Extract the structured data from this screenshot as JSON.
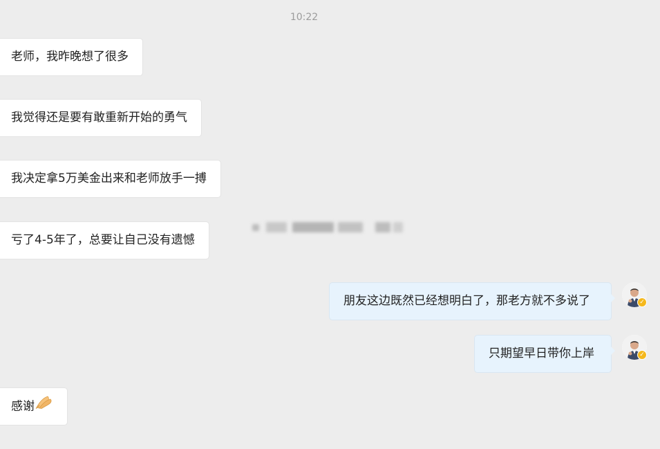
{
  "chat": {
    "timestamp": "10:22",
    "messages": [
      {
        "side": "in",
        "text": "老师，我昨晚想了很多"
      },
      {
        "side": "in",
        "text": "我觉得还是要有敢重新开始的勇气"
      },
      {
        "side": "in",
        "text": "我决定拿5万美金出来和老师放手一搏"
      },
      {
        "side": "in",
        "text": "亏了4-5年了，总要让自己没有遗憾"
      },
      {
        "side": "out",
        "text": "朋友这边既然已经想明白了，那老方就不多说了"
      },
      {
        "side": "out",
        "text": "只期望早日带你上岸"
      },
      {
        "side": "in",
        "text": "感谢",
        "emoji": "praying-hands-icon"
      }
    ]
  },
  "colors": {
    "background": "#ededed",
    "incoming_bubble": "#ffffff",
    "outgoing_bubble": "#e7f3fd",
    "timestamp_text": "#9b9b9b",
    "verified_badge": "#f5b81c"
  },
  "icons": {
    "avatar": "user-avatar-icon",
    "verified": "verified-badge-icon",
    "redacted": "blurred-watermark"
  }
}
